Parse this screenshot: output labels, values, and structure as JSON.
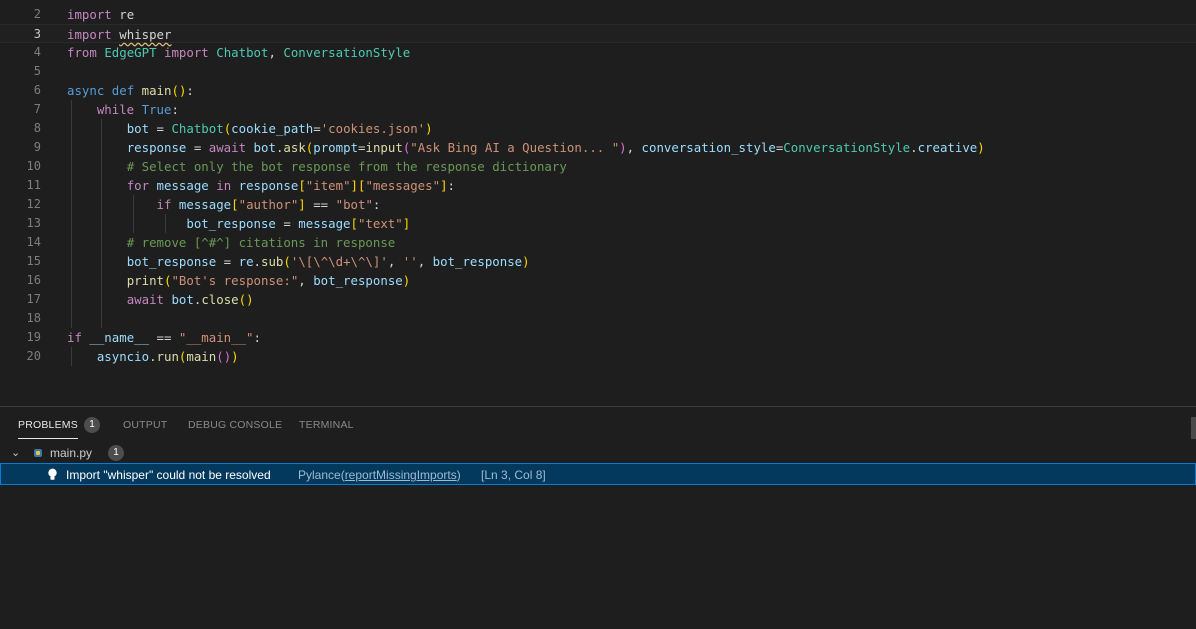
{
  "editor": {
    "lines": [
      {
        "num": "2",
        "tokens": [
          [
            "kw",
            "import"
          ],
          [
            "op",
            " "
          ],
          [
            "mod",
            "re"
          ]
        ]
      },
      {
        "num": "3",
        "current": true,
        "tokens": [
          [
            "kw",
            "import"
          ],
          [
            "op",
            " "
          ],
          [
            "mod squig",
            "whisper"
          ]
        ]
      },
      {
        "num": "4",
        "tokens": [
          [
            "kw",
            "from"
          ],
          [
            "op",
            " "
          ],
          [
            "cls",
            "EdgeGPT"
          ],
          [
            "op",
            " "
          ],
          [
            "kw",
            "import"
          ],
          [
            "op",
            " "
          ],
          [
            "cls",
            "Chatbot"
          ],
          [
            "op",
            ", "
          ],
          [
            "cls",
            "ConversationStyle"
          ]
        ]
      },
      {
        "num": "5",
        "tokens": []
      },
      {
        "num": "6",
        "tokens": [
          [
            "kwb",
            "async"
          ],
          [
            "op",
            " "
          ],
          [
            "kwb",
            "def"
          ],
          [
            "op",
            " "
          ],
          [
            "fn",
            "main"
          ],
          [
            "br1",
            "()"
          ],
          [
            "op",
            ":"
          ]
        ]
      },
      {
        "num": "7",
        "tokens": [
          [
            "op",
            "    "
          ],
          [
            "kw",
            "while"
          ],
          [
            "op",
            " "
          ],
          [
            "kwb",
            "True"
          ],
          [
            "op",
            ":"
          ]
        ]
      },
      {
        "num": "8",
        "tokens": [
          [
            "op",
            "        "
          ],
          [
            "var",
            "bot"
          ],
          [
            "op",
            " = "
          ],
          [
            "cls",
            "Chatbot"
          ],
          [
            "br1",
            "("
          ],
          [
            "var",
            "cookie_path"
          ],
          [
            "op",
            "="
          ],
          [
            "str",
            "'cookies.json'"
          ],
          [
            "br1",
            ")"
          ]
        ]
      },
      {
        "num": "9",
        "tokens": [
          [
            "op",
            "        "
          ],
          [
            "var",
            "response"
          ],
          [
            "op",
            " = "
          ],
          [
            "kw",
            "await"
          ],
          [
            "op",
            " "
          ],
          [
            "var",
            "bot"
          ],
          [
            "op",
            "."
          ],
          [
            "fn",
            "ask"
          ],
          [
            "br1",
            "("
          ],
          [
            "var",
            "prompt"
          ],
          [
            "op",
            "="
          ],
          [
            "fn",
            "input"
          ],
          [
            "br2",
            "("
          ],
          [
            "str",
            "\"Ask Bing AI a Question... \""
          ],
          [
            "br2",
            ")"
          ],
          [
            "op",
            ", "
          ],
          [
            "var",
            "conversation_style"
          ],
          [
            "op",
            "="
          ],
          [
            "cls",
            "ConversationStyle"
          ],
          [
            "op",
            "."
          ],
          [
            "var",
            "creative"
          ],
          [
            "br1",
            ")"
          ]
        ]
      },
      {
        "num": "10",
        "tokens": [
          [
            "op",
            "        "
          ],
          [
            "cmt",
            "# Select only the bot response from the response dictionary"
          ]
        ]
      },
      {
        "num": "11",
        "tokens": [
          [
            "op",
            "        "
          ],
          [
            "kw",
            "for"
          ],
          [
            "op",
            " "
          ],
          [
            "var",
            "message"
          ],
          [
            "op",
            " "
          ],
          [
            "kw",
            "in"
          ],
          [
            "op",
            " "
          ],
          [
            "var",
            "response"
          ],
          [
            "br1",
            "["
          ],
          [
            "str",
            "\"item\""
          ],
          [
            "br1",
            "]["
          ],
          [
            "str",
            "\"messages\""
          ],
          [
            "br1",
            "]"
          ],
          [
            "op",
            ":"
          ]
        ]
      },
      {
        "num": "12",
        "tokens": [
          [
            "op",
            "            "
          ],
          [
            "kw",
            "if"
          ],
          [
            "op",
            " "
          ],
          [
            "var",
            "message"
          ],
          [
            "br1",
            "["
          ],
          [
            "str",
            "\"author\""
          ],
          [
            "br1",
            "]"
          ],
          [
            "op",
            " == "
          ],
          [
            "str",
            "\"bot\""
          ],
          [
            "op",
            ":"
          ]
        ]
      },
      {
        "num": "13",
        "tokens": [
          [
            "op",
            "                "
          ],
          [
            "var",
            "bot_response"
          ],
          [
            "op",
            " = "
          ],
          [
            "var",
            "message"
          ],
          [
            "br1",
            "["
          ],
          [
            "str",
            "\"text\""
          ],
          [
            "br1",
            "]"
          ]
        ]
      },
      {
        "num": "14",
        "tokens": [
          [
            "op",
            "        "
          ],
          [
            "cmt",
            "# remove [^#^] citations in response"
          ]
        ]
      },
      {
        "num": "15",
        "tokens": [
          [
            "op",
            "        "
          ],
          [
            "var",
            "bot_response"
          ],
          [
            "op",
            " = "
          ],
          [
            "var",
            "re"
          ],
          [
            "op",
            "."
          ],
          [
            "fn",
            "sub"
          ],
          [
            "br1",
            "("
          ],
          [
            "str",
            "'\\[\\^\\d+\\^\\]'"
          ],
          [
            "op",
            ", "
          ],
          [
            "str",
            "''"
          ],
          [
            "op",
            ", "
          ],
          [
            "var",
            "bot_response"
          ],
          [
            "br1",
            ")"
          ]
        ]
      },
      {
        "num": "16",
        "tokens": [
          [
            "op",
            "        "
          ],
          [
            "fn",
            "print"
          ],
          [
            "br1",
            "("
          ],
          [
            "str",
            "\"Bot's response:\""
          ],
          [
            "op",
            ", "
          ],
          [
            "var",
            "bot_response"
          ],
          [
            "br1",
            ")"
          ]
        ]
      },
      {
        "num": "17",
        "tokens": [
          [
            "op",
            "        "
          ],
          [
            "kw",
            "await"
          ],
          [
            "op",
            " "
          ],
          [
            "var",
            "bot"
          ],
          [
            "op",
            "."
          ],
          [
            "fn",
            "close"
          ],
          [
            "br1",
            "()"
          ]
        ]
      },
      {
        "num": "18",
        "tokens": []
      },
      {
        "num": "19",
        "tokens": [
          [
            "kw",
            "if"
          ],
          [
            "op",
            " "
          ],
          [
            "var",
            "__name__"
          ],
          [
            "op",
            " == "
          ],
          [
            "str",
            "\"__main__\""
          ],
          [
            "op",
            ":"
          ]
        ]
      },
      {
        "num": "20",
        "tokens": [
          [
            "op",
            "    "
          ],
          [
            "var",
            "asyncio"
          ],
          [
            "op",
            "."
          ],
          [
            "fn",
            "run"
          ],
          [
            "br1",
            "("
          ],
          [
            "fn",
            "main"
          ],
          [
            "br2",
            "()"
          ],
          [
            "br1",
            ")"
          ]
        ]
      }
    ]
  },
  "panel": {
    "tabs": [
      {
        "label": "PROBLEMS",
        "active": true,
        "badge": "1"
      },
      {
        "label": "OUTPUT"
      },
      {
        "label": "DEBUG CONSOLE"
      },
      {
        "label": "TERMINAL"
      }
    ],
    "file": {
      "name": "main.py",
      "count": "1"
    },
    "problem": {
      "message": "Import \"whisper\" could not be resolved",
      "source": "Pylance(",
      "rule": "reportMissingImports",
      "source_close": ")",
      "location": "[Ln 3, Col 8]"
    }
  }
}
